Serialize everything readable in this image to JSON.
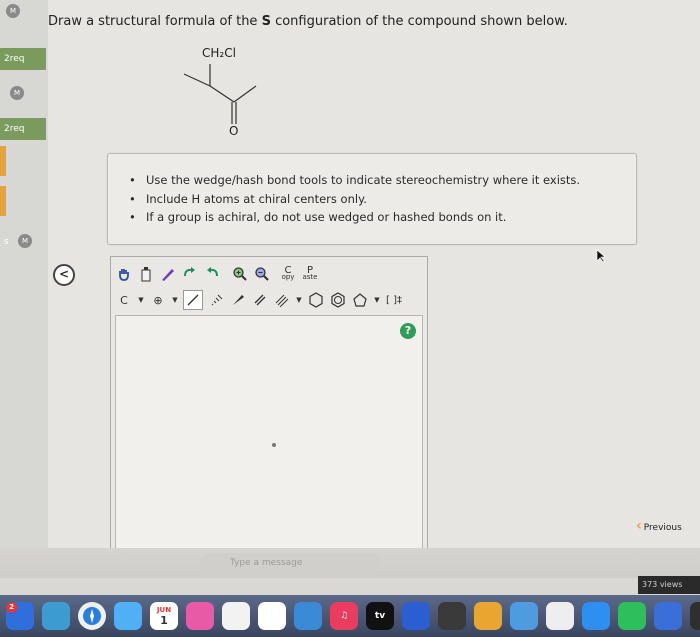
{
  "question": {
    "prefix": "Draw a structural formula of the ",
    "bold": "S",
    "suffix": " configuration of the compound shown below."
  },
  "molecule": {
    "top_label": "CH₂Cl",
    "bottom_label": "O"
  },
  "instructions": [
    "Use the wedge/hash bond tools to indicate stereochemistry where it exists.",
    "Include H atoms at chiral centers only.",
    "If a group is achiral, do not use wedged or hashed bonds on it."
  ],
  "sidebar": {
    "items": [
      {
        "badge": "M"
      },
      {
        "label": "2req"
      },
      {
        "badge": "M"
      },
      {
        "label": "2req"
      },
      {
        "text": "s",
        "badge": "M"
      }
    ]
  },
  "editor": {
    "toolbar1": {
      "copy": {
        "letter": "C",
        "sub": "opy"
      },
      "paste": {
        "letter": "P",
        "sub": "aste"
      }
    },
    "toolbar2": {
      "atom": "C",
      "charge": "⊕",
      "brackets": "[ ]‡"
    },
    "help": "?"
  },
  "previous_label": "Previous",
  "collapse_label": "<",
  "bottom": {
    "input_placeholder": "Type a message",
    "views": "373 views"
  },
  "dock": {
    "calendar_month": "JUN",
    "calendar_day": "1",
    "tv_label": "tv",
    "badge": "2"
  },
  "colors": {
    "accent_green": "#7a9a5e",
    "accent_orange": "#e7a33b",
    "help_green": "#2e9e57"
  }
}
